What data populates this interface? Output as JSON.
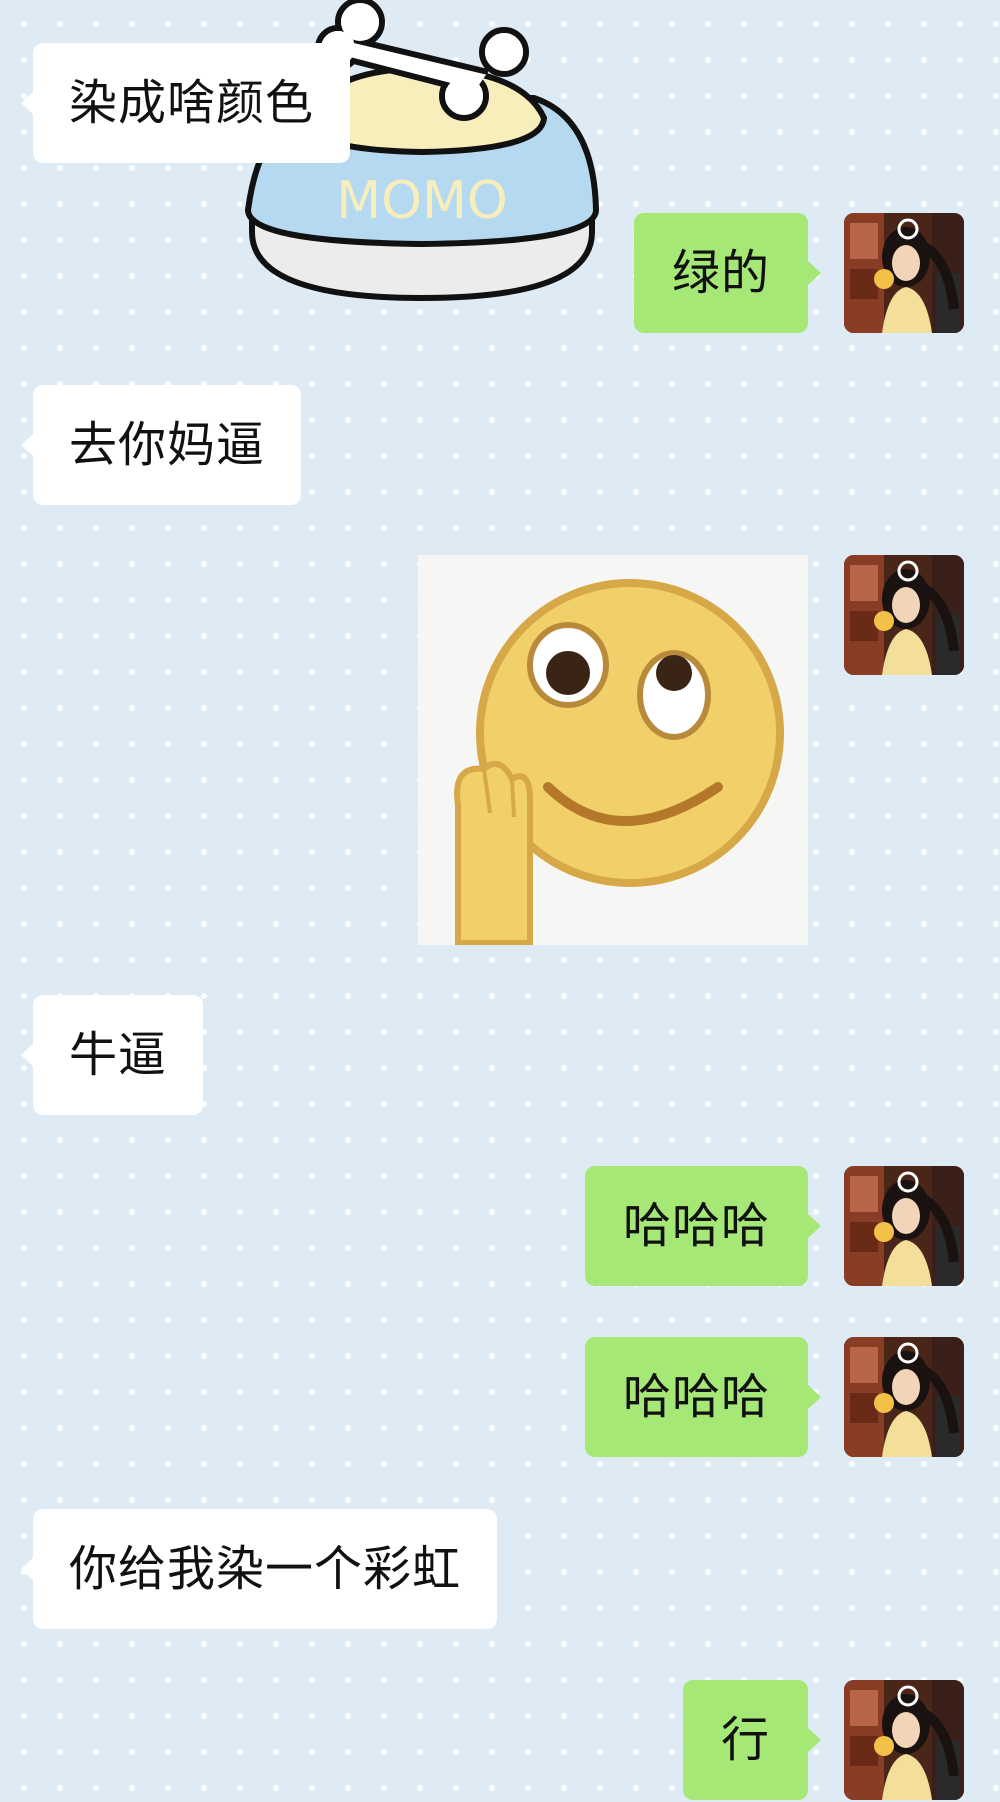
{
  "messages": [
    {
      "side": "left",
      "text": "染成啥颜色"
    },
    {
      "side": "right",
      "text": "绿的"
    },
    {
      "side": "left",
      "text": "去你妈逼"
    },
    {
      "side": "right",
      "type": "sticker",
      "sticker": "smirk-emoji"
    },
    {
      "side": "left",
      "text": "牛逼"
    },
    {
      "side": "right",
      "text": "哈哈哈"
    },
    {
      "side": "right",
      "text": "哈哈哈"
    },
    {
      "side": "left",
      "text": "你给我染一个彩虹"
    },
    {
      "side": "right",
      "text": "行"
    }
  ],
  "stickers": {
    "momo_label": "MOMO"
  },
  "colors": {
    "background": "#deebf5",
    "incoming_bubble": "#ffffff",
    "outgoing_bubble": "#a5e876"
  }
}
